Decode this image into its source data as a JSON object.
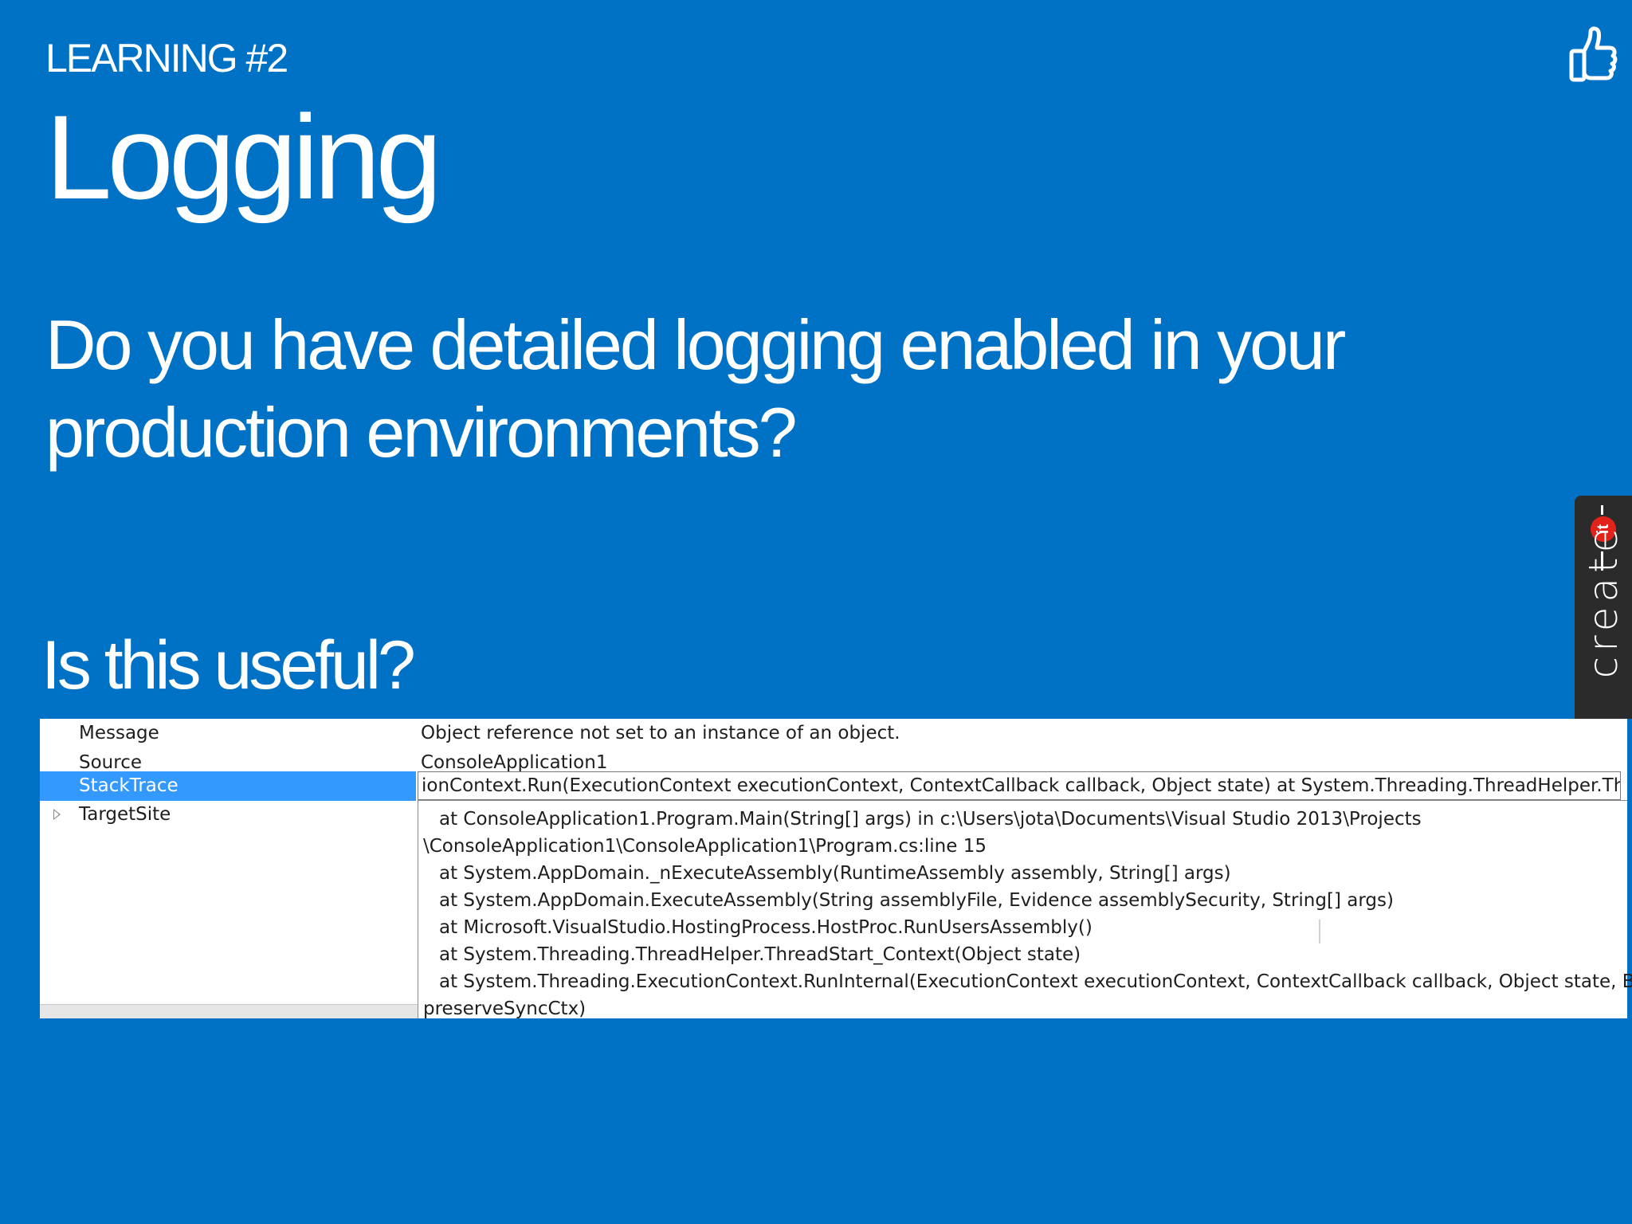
{
  "slide": {
    "eyebrow": "LEARNING #2",
    "title": "Logging",
    "question": "Do you have detailed logging enabled in your production environments?",
    "subquestion": "Is this useful?",
    "background_color": "#0072C6"
  },
  "brand": {
    "name": "create",
    "badge": "it",
    "badge_color": "#E2231A",
    "icon": "thumbs-up-icon"
  },
  "exception_grid": {
    "rows": [
      {
        "key": "Message",
        "value": "Object reference not set to an instance of an object."
      },
      {
        "key": "Source",
        "value": "ConsoleApplication1"
      },
      {
        "key": "StackTrace",
        "value": "ionContext.Run(ExecutionContext executionContext, ContextCallback callback, Object state)    at System.Threading.ThreadHelper.ThreadStart()"
      },
      {
        "key": "TargetSite",
        "value": ""
      }
    ],
    "selected_row": "StackTrace",
    "stacktrace_popup": [
      "at ConsoleApplication1.Program.Main(String[] args) in c:\\Users\\jota\\Documents\\Visual Studio 2013\\Projects",
      "\\ConsoleApplication1\\ConsoleApplication1\\Program.cs:line 15",
      "at System.AppDomain._nExecuteAssembly(RuntimeAssembly assembly, String[] args)",
      "at System.AppDomain.ExecuteAssembly(String assemblyFile, Evidence assemblySecurity, String[] args)",
      "at Microsoft.VisualStudio.HostingProcess.HostProc.RunUsersAssembly()",
      "at System.Threading.ThreadHelper.ThreadStart_Context(Object state)",
      "at System.Threading.ExecutionContext.RunInternal(ExecutionContext executionContext, ContextCallback callback, Object state, Boolean",
      "preserveSyncCtx)"
    ]
  }
}
